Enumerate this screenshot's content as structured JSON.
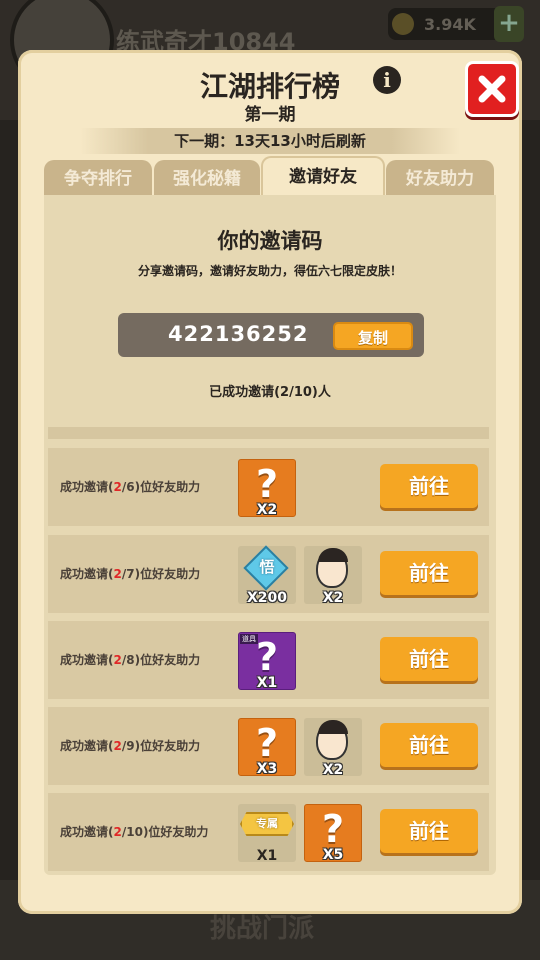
{
  "background": {
    "player_name": "练武奇才10844",
    "currency": "3.94K",
    "footer_text": "挑战门派"
  },
  "panel": {
    "title": "江湖排行榜",
    "subtitle": "第一期",
    "refresh_text": "下一期：13天13小时后刷新"
  },
  "tabs": [
    {
      "label": "争夺排行",
      "active": false
    },
    {
      "label": "强化秘籍",
      "active": false
    },
    {
      "label": "邀请好友",
      "active": true
    },
    {
      "label": "好友助力",
      "active": false
    }
  ],
  "invite": {
    "heading": "你的邀请码",
    "description": "分享邀请码，邀请好友助力，得伍六七限定皮肤！",
    "code": "422136252",
    "copy_label": "复制",
    "invited_status": "已成功邀请(2/10)人"
  },
  "rows": [
    {
      "prefix": "成功邀请(",
      "current": "2",
      "target": "/6)位好友助力",
      "button": "前往",
      "rewards": [
        {
          "icon": "orange-mystery-icon",
          "qty": "X2"
        }
      ]
    },
    {
      "prefix": "成功邀请(",
      "current": "2",
      "target": "/7)位好友助力",
      "button": "前往",
      "rewards": [
        {
          "icon": "wu-diamond-icon",
          "qty": "X200"
        },
        {
          "icon": "character-portrait-icon",
          "qty": "X2"
        }
      ]
    },
    {
      "prefix": "成功邀请(",
      "current": "2",
      "target": "/8)位好友助力",
      "button": "前往",
      "rewards": [
        {
          "icon": "purple-mystery-icon",
          "qty": "X1",
          "tag": "道具"
        }
      ]
    },
    {
      "prefix": "成功邀请(",
      "current": "2",
      "target": "/9)位好友助力",
      "button": "前往",
      "rewards": [
        {
          "icon": "orange-mystery-icon",
          "qty": "X3"
        },
        {
          "icon": "character-portrait-icon",
          "qty": "X2"
        }
      ]
    },
    {
      "prefix": "成功邀请(",
      "current": "2",
      "target": "/10)位好友助力",
      "button": "前往",
      "rewards": [
        {
          "icon": "exclusive-badge-icon",
          "label": "专属",
          "qty": "X1"
        },
        {
          "icon": "orange-mystery-icon",
          "qty": "X5"
        }
      ]
    }
  ],
  "colors": {
    "panel_bg": "#f6e8c6",
    "button_orange": "#f5a623",
    "highlight_red": "#e02828",
    "close_red": "#e12020"
  }
}
